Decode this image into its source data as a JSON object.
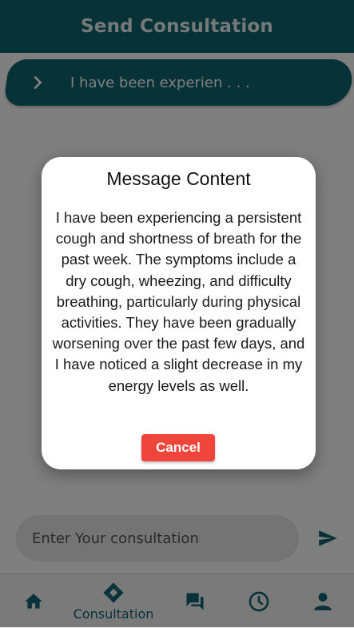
{
  "appbar": {
    "title": "Send Consultation"
  },
  "message_list": [
    {
      "preview": "I have been experien . . ."
    }
  ],
  "composer": {
    "placeholder": "Enter Your consultation"
  },
  "bottom_nav": {
    "items": [
      {
        "icon": "home-icon"
      },
      {
        "icon": "consultation-icon",
        "label": "Consultation",
        "active": true
      },
      {
        "icon": "chat-icon"
      },
      {
        "icon": "history-icon"
      },
      {
        "icon": "profile-icon"
      }
    ]
  },
  "dialog": {
    "title": "Message Content",
    "body": "I have been experiencing a persistent cough and shortness of breath for the past week. The symptoms include a dry cough, wheezing, and difficulty breathing, particularly during physical activities. They have been gradually worsening over the past few days, and I have noticed a slight decrease in my energy levels as well.",
    "cancel_label": "Cancel"
  },
  "colors": {
    "primary": "#0d6471",
    "danger": "#f0453a"
  }
}
